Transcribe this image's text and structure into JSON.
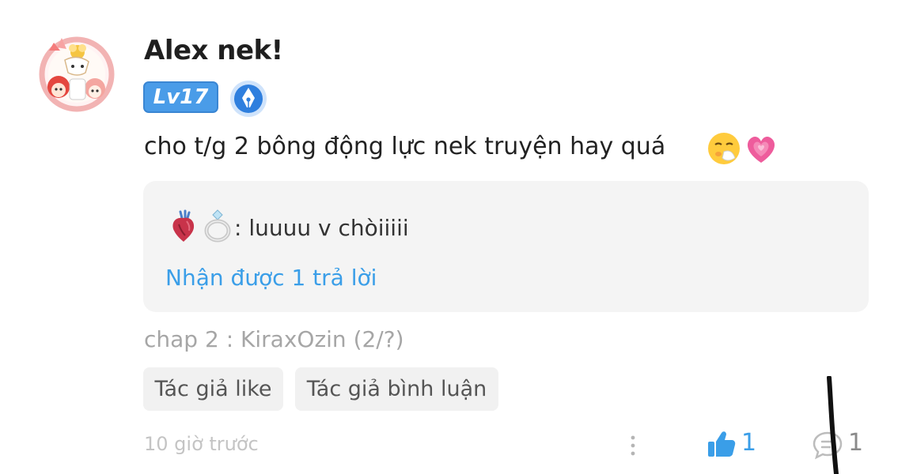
{
  "comment": {
    "author": "Alex nek!",
    "level": "Lv17",
    "text": "cho t/g 2 bông động lực nek truyện hay quá",
    "emojis": [
      "sneezing-face",
      "growing-heart"
    ]
  },
  "reply": {
    "text": ": luuuu v chòiiiii",
    "emojis": [
      "anatomical-heart",
      "ring"
    ],
    "replies_link": "Nhận được 1 trả lời"
  },
  "chapter": "chap 2 : KiraxOzin (2/?)",
  "tags": [
    "Tác giả like",
    "Tác giả bình luận"
  ],
  "footer": {
    "time": "10 giờ trước",
    "likes": "1",
    "comments": "1"
  },
  "colors": {
    "accent": "#3a9ee8",
    "level_badge": "#4a9ce8",
    "muted_text": "#a6a6a6",
    "reply_background": "#f4f4f4"
  }
}
